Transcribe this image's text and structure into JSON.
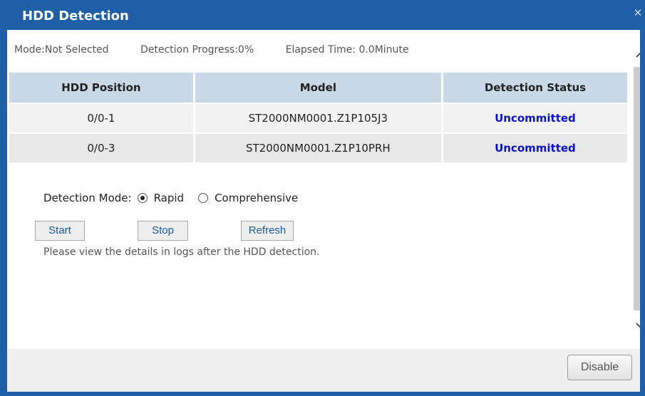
{
  "window": {
    "title": "HDD Detection",
    "close_glyph": "✕"
  },
  "status": {
    "mode": "Mode:Not Selected",
    "progress": "Detection Progress:0%",
    "elapsed": "Elapsed Time: 0.0Minute"
  },
  "table": {
    "headers": [
      "HDD Position",
      "Model",
      "Detection Status"
    ],
    "rows": [
      {
        "position": "0/0-1",
        "model": "ST2000NM0001.Z1P105J3",
        "status": "Uncommitted"
      },
      {
        "position": "0/0-3",
        "model": "ST2000NM0001.Z1P10PRH",
        "status": "Uncommitted"
      }
    ]
  },
  "detection_mode": {
    "label": "Detection Mode:",
    "options": [
      "Rapid",
      "Comprehensive"
    ],
    "selected": "Rapid"
  },
  "buttons": {
    "start": "Start",
    "stop": "Stop",
    "refresh": "Refresh",
    "disable": "Disable"
  },
  "hint": "Please view the details in logs after the HDD detection.",
  "scrollbar": {
    "up_glyph": "^",
    "down_glyph": "v"
  },
  "colors": {
    "titlebar": "#1f5fa8",
    "status_text": "#0b12c8",
    "header_bg": "#c9d9e8"
  }
}
